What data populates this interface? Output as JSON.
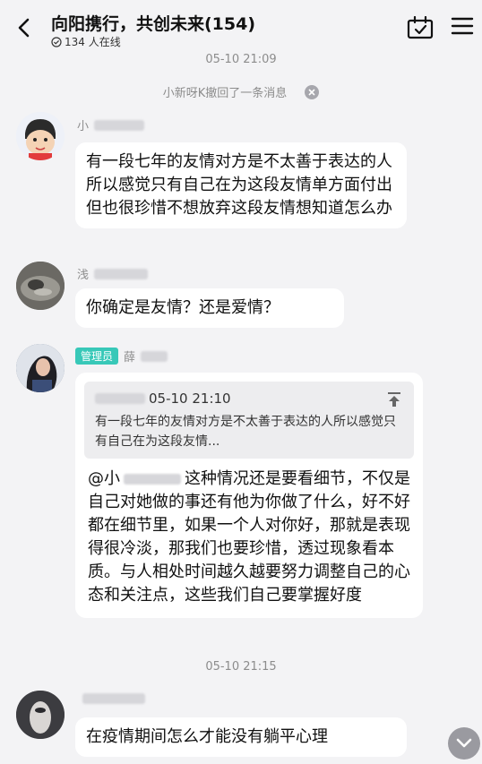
{
  "header": {
    "title": "向阳携行，共创未来(154)",
    "online": "134 人在线"
  },
  "timestamps": [
    "05-10 21:09",
    "05-10 21:15"
  ],
  "system_notice": "小新呀K撤回了一条消息",
  "messages": [
    {
      "sender_visible": "小",
      "text": "有一段七年的友情对方是不太善于表达的人所以感觉只有自己在为这段友情单方面付出但也很珍惜不想放弃这段友情想知道怎么办"
    },
    {
      "sender_visible": "浅",
      "text": "你确定是友情？还是爱情？"
    },
    {
      "badge": "管理员",
      "sender_visible": "薛",
      "reply_time": "05-10 21:10",
      "reply_quote": "有一段七年的友情对方是不太善于表达的人所以感觉只有自己在为这段友情...",
      "mention_prefix": "@小",
      "text": "这种情况还是要看细节，不仅是自己对她做的事还有他为你做了什么，好不好都在细节里，如果一个人对你好，那就是表现得很冷淡，那我们也要珍惜，透过现象看本质。与人相处时间越久越要努力调整自己的心态和关注点，这些我们自己要掌握好度"
    },
    {
      "sender_visible": "",
      "text": "在疫情期间怎么才能没有躺平心理"
    }
  ],
  "icons": {
    "back": "back-arrow-icon",
    "calendar": "calendar-check-icon",
    "menu": "hamburger-menu-icon",
    "close": "close-circle-icon",
    "pin": "pin-top-icon",
    "scroll": "chevron-down-icon"
  },
  "colors": {
    "background": "#f3f3f5",
    "bubble": "#ffffff",
    "badge": "#38c8b8",
    "timestamp": "#8c8c8c"
  }
}
